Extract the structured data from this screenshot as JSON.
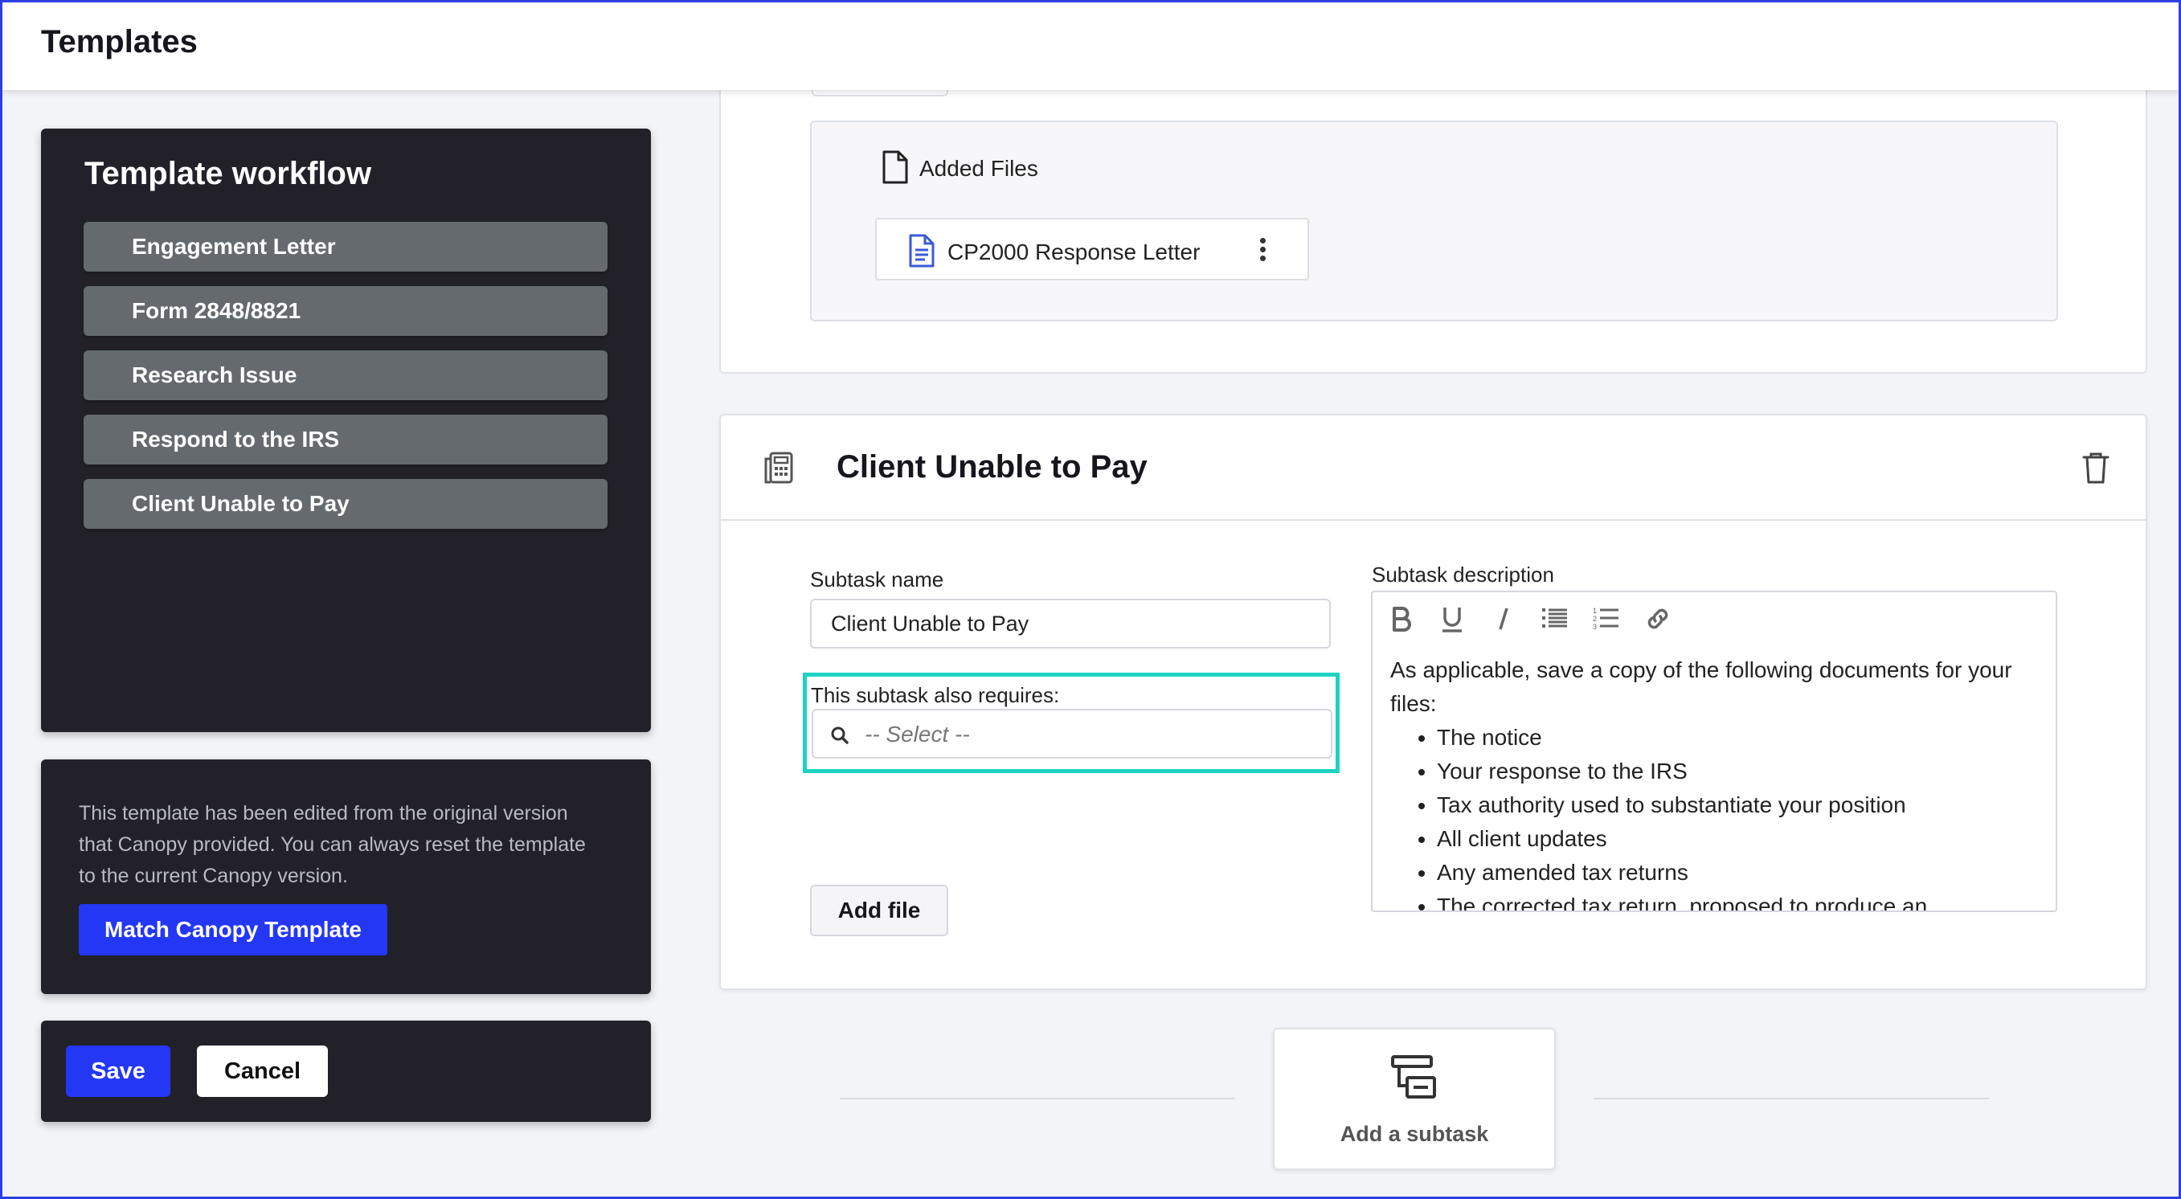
{
  "header": {
    "title": "Templates"
  },
  "workflow": {
    "title": "Template workflow",
    "items": [
      {
        "label": "Engagement Letter"
      },
      {
        "label": "Form 2848/8821"
      },
      {
        "label": "Research Issue"
      },
      {
        "label": "Respond to the IRS"
      },
      {
        "label": "Client Unable to Pay"
      }
    ]
  },
  "reset_notice": {
    "text": "This template has been edited from the original version that Canopy provided. You can always reset the template to the current Canopy version.",
    "button_label": "Match Canopy Template"
  },
  "actions": {
    "save_label": "Save",
    "cancel_label": "Cancel"
  },
  "files": {
    "section_label": "Added Files",
    "items": [
      {
        "name": "CP2000 Response Letter"
      }
    ]
  },
  "subtask": {
    "title": "Client Unable to Pay",
    "name_label": "Subtask name",
    "name_value": "Client Unable to Pay",
    "requires_label": "This subtask also requires:",
    "requires_placeholder": "-- Select --",
    "description_label": "Subtask description",
    "description_intro": "As applicable, save a copy of the following documents for your files:",
    "description_items": [
      "The notice",
      "Your response to the IRS",
      "Tax authority used to substantiate your position",
      "All client updates",
      "Any amended tax returns",
      "The corrected tax return, proposed to produce an"
    ],
    "add_file_label": "Add file"
  },
  "toolbar": {
    "tools": [
      "bold-icon",
      "underline-icon",
      "italic-icon",
      "bulleted-list-icon",
      "numbered-list-icon",
      "link-icon"
    ]
  },
  "add_subtask": {
    "label": "Add a subtask"
  },
  "colors": {
    "accent": "#2437f5",
    "highlight": "#1ed3c3",
    "panel": "#222129",
    "item": "#646a6e"
  }
}
